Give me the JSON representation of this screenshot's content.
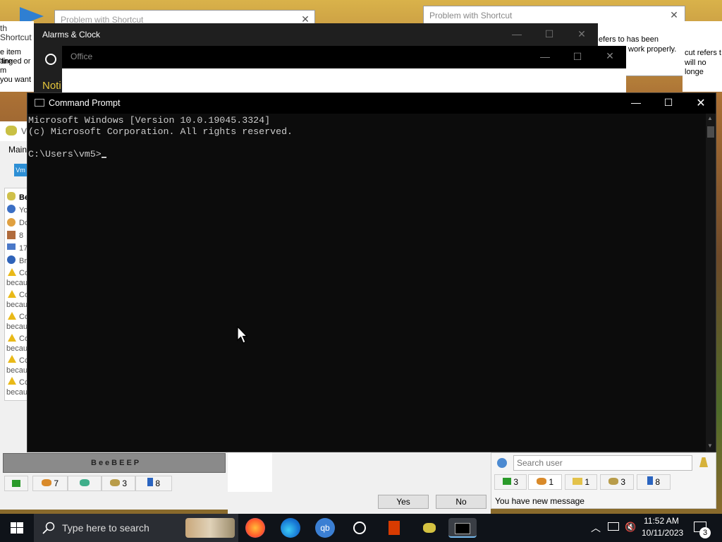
{
  "problem_left": {
    "title": "Problem with Shortcut",
    "side_title": "th Shortcut",
    "lines": [
      "e item 'fire",
      "anged or m",
      "you want"
    ]
  },
  "problem_right": {
    "title": "Problem with Shortcut",
    "line1": "efers to has been",
    "line2": "work properly.",
    "far_line1": "cut refers t",
    "far_line2": "will no longe"
  },
  "alarms": {
    "title": "Alarms & Clock",
    "partial_text": "Noti"
  },
  "office": {
    "title": "Office"
  },
  "cmd": {
    "title": "Command Prompt",
    "lines": [
      "Microsoft Windows [Version 10.0.19045.3324]",
      "(c) Microsoft Corporation. All rights reserved.",
      "",
      "C:\\Users\\vm5>"
    ]
  },
  "beebeep_left": {
    "title_partial": "V",
    "menu_partial": "Main",
    "list": [
      "Be",
      "Yo",
      "Do",
      "8",
      "17",
      "Br",
      "Co",
      "becau",
      "Co",
      "becau",
      "Co",
      "becau",
      "Co",
      "becau",
      "Co",
      "becau",
      "Co",
      "becau"
    ],
    "banner": "BeeBEEP",
    "tabs": [
      {
        "icon": "chat-icon",
        "count": ""
      },
      {
        "icon": "users-icon",
        "count": "7"
      },
      {
        "icon": "chats-icon",
        "count": ""
      },
      {
        "icon": "groups-icon",
        "count": "3"
      },
      {
        "icon": "pin-icon",
        "count": "8"
      }
    ]
  },
  "beebeep_right": {
    "search_placeholder": "Search user",
    "tabs": [
      {
        "icon": "chat-icon",
        "count": "3"
      },
      {
        "icon": "users-icon",
        "count": "1"
      },
      {
        "icon": "folder-icon",
        "count": "1"
      },
      {
        "icon": "groups-icon",
        "count": "3"
      },
      {
        "icon": "pin-icon",
        "count": "8"
      }
    ],
    "status": "You have new message"
  },
  "dialog_buttons": {
    "yes": "Yes",
    "no": "No"
  },
  "taskbar": {
    "search_placeholder": "Type here to search",
    "time": "11:52 AM",
    "date": "10/11/2023",
    "notification_count": "3"
  }
}
